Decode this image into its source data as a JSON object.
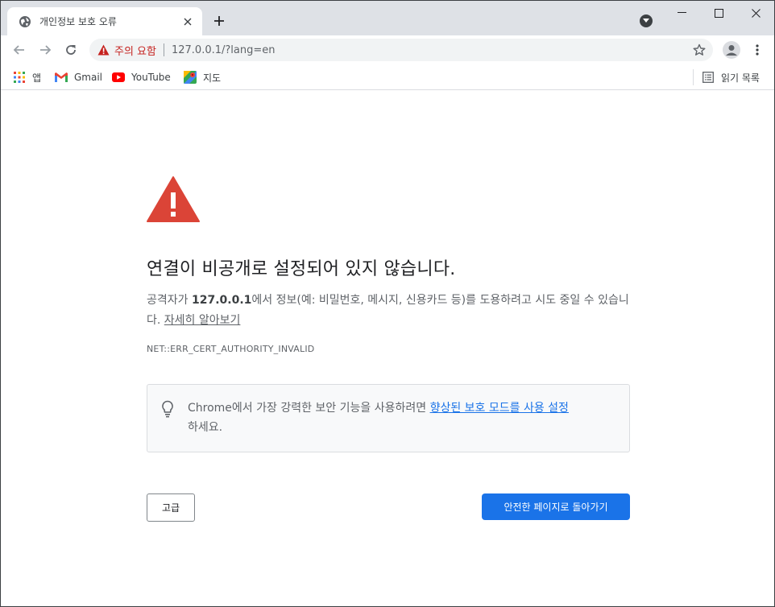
{
  "tab": {
    "title": "개인정보 보호 오류"
  },
  "omnibox": {
    "security_label": "주의 요함",
    "url": "127.0.0.1/?lang=en"
  },
  "bookmarks": {
    "apps": "앱",
    "gmail": "Gmail",
    "youtube": "YouTube",
    "maps": "지도",
    "reading_list": "읽기 목록"
  },
  "interstitial": {
    "heading": "연결이 비공개로 설정되어 있지 않습니다.",
    "explanation_prefix": "공격자가 ",
    "host": "127.0.0.1",
    "explanation_suffix": "에서 정보(예: 비밀번호, 메시지, 신용카드 등)를 도용하려고 시도 중일 수 있습니다. ",
    "learn_more": "자세히 알아보기",
    "error_code": "NET::ERR_CERT_AUTHORITY_INVALID",
    "enhanced_prefix": "Chrome에서 가장 강력한 보안 기능을 사용하려면 ",
    "enhanced_link": "향상된 보호 모드를 사용 설정",
    "enhanced_suffix": "하세요.",
    "advanced_button": "고급",
    "back_button": "안전한 페이지로 돌아가기"
  },
  "colors": {
    "primary_blue": "#1a73e8",
    "warning_red": "#db4437",
    "security_red": "#c5221f"
  },
  "icons": {
    "tab_favicon": "globe-icon",
    "warning": "warning-triangle-icon",
    "bulb": "lightbulb-icon"
  }
}
